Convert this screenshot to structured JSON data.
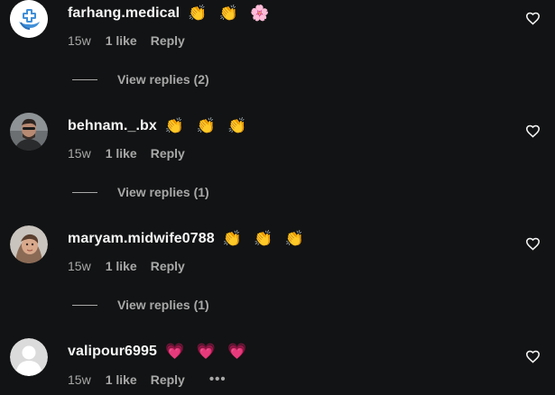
{
  "comments": [
    {
      "username": "farhang.medical",
      "text": "👏 👏 🌸",
      "time": "15w",
      "likes": "1 like",
      "reply": "Reply",
      "view_replies": "View replies (2)",
      "avatar": "medical-logo-avatar"
    },
    {
      "username": "behnam._.bx",
      "text": "👏 👏 👏",
      "time": "15w",
      "likes": "1 like",
      "reply": "Reply",
      "view_replies": "View replies (1)",
      "avatar": "profile-photo-avatar"
    },
    {
      "username": "maryam.midwife0788",
      "text": "👏 👏 👏",
      "time": "15w",
      "likes": "1 like",
      "reply": "Reply",
      "view_replies": "View replies (1)",
      "avatar": "profile-photo-avatar"
    },
    {
      "username": "valipour6995",
      "text": "💗 💗 💗",
      "time": "15w",
      "likes": "1 like",
      "reply": "Reply",
      "more": "•••",
      "avatar": "default-user-avatar"
    }
  ],
  "colors": {
    "background": "#121314",
    "primary_text": "#f5f5f5",
    "secondary_text": "#a8a8a8"
  },
  "icons": [
    "heart-outline-icon",
    "more-options-icon"
  ]
}
